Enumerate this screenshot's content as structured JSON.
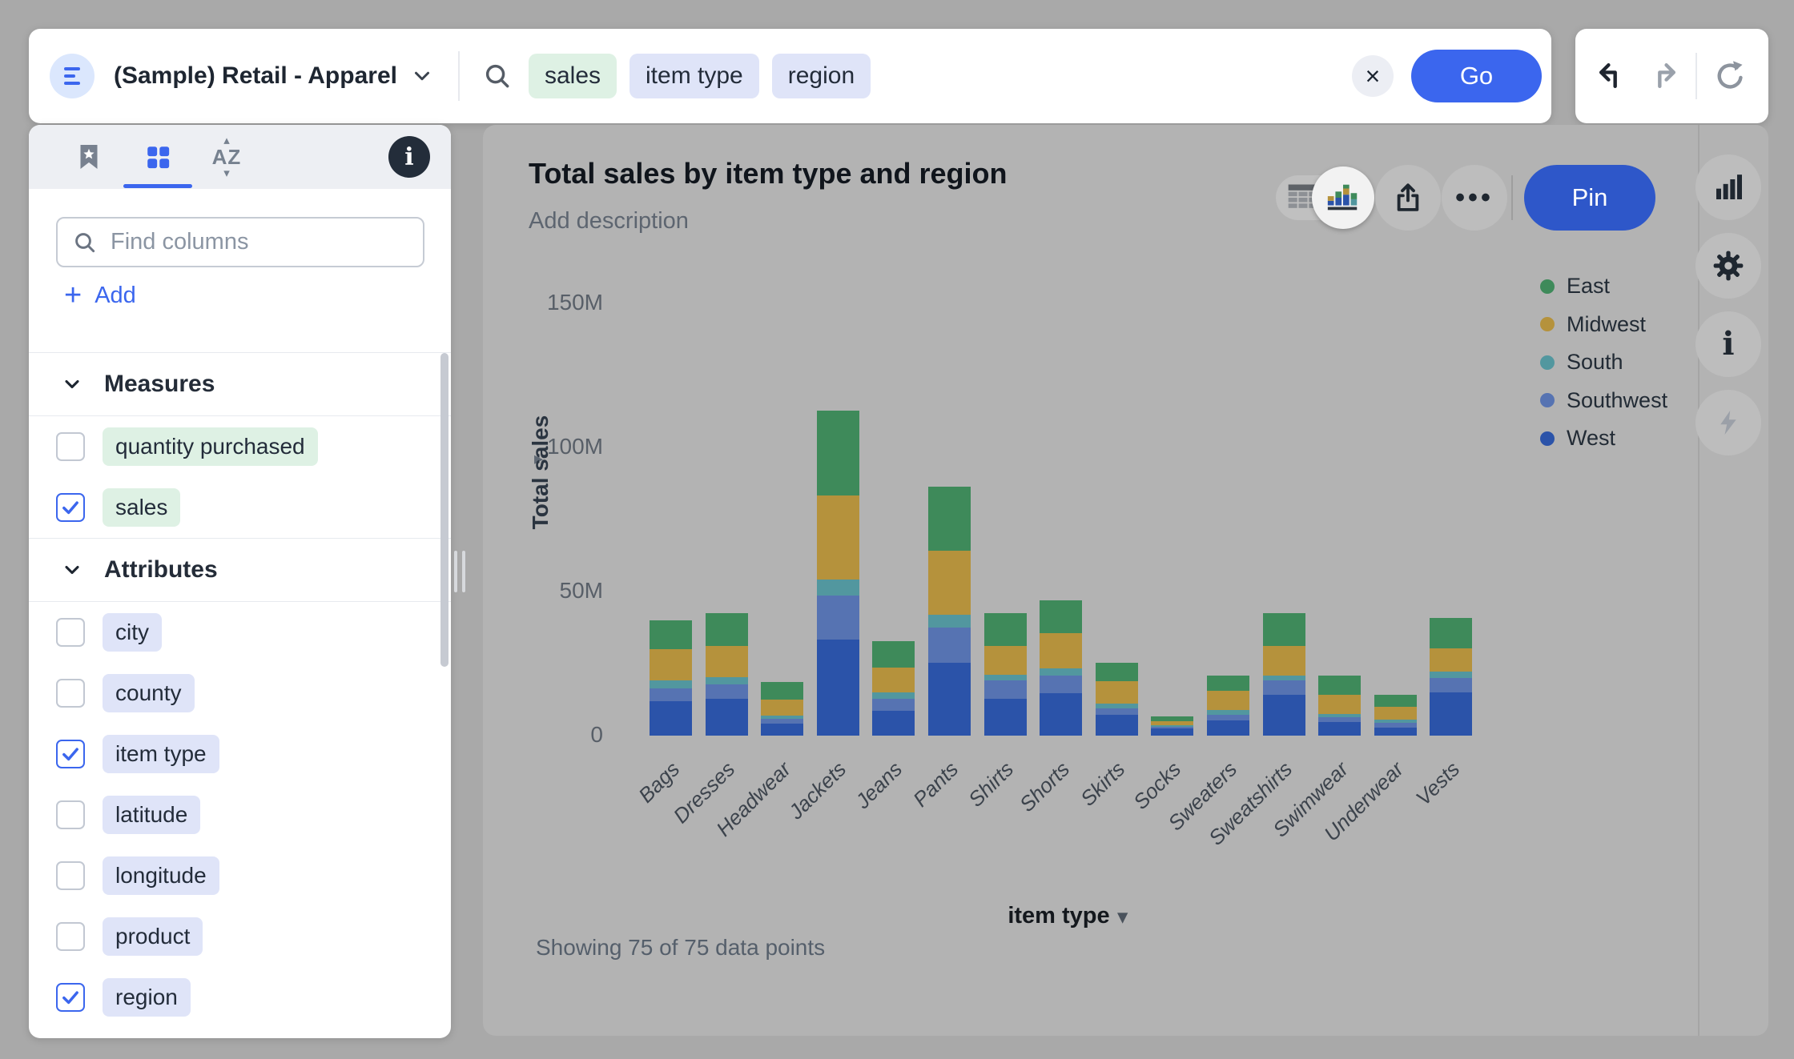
{
  "topbar": {
    "datasource": "(Sample) Retail - Apparel",
    "tokens": [
      {
        "text": "sales",
        "kind": "measure"
      },
      {
        "text": "item type",
        "kind": "attribute"
      },
      {
        "text": "region",
        "kind": "attribute"
      }
    ],
    "go_label": "Go",
    "clear_glyph": "×"
  },
  "history": {
    "undo": "undo",
    "redo": "redo",
    "reset": "reset"
  },
  "sidebar": {
    "search_placeholder": "Find columns",
    "add_label": "Add",
    "add_plus_glyph": "+",
    "az_text": "AZ",
    "info_glyph": "i",
    "sections": [
      {
        "title": "Measures",
        "items": [
          {
            "label": "quantity purchased",
            "kind": "measure",
            "checked": false
          },
          {
            "label": "sales",
            "kind": "measure",
            "checked": true
          }
        ]
      },
      {
        "title": "Attributes",
        "items": [
          {
            "label": "city",
            "kind": "attribute",
            "checked": false
          },
          {
            "label": "county",
            "kind": "attribute",
            "checked": false
          },
          {
            "label": "item type",
            "kind": "attribute",
            "checked": true
          },
          {
            "label": "latitude",
            "kind": "attribute",
            "checked": false
          },
          {
            "label": "longitude",
            "kind": "attribute",
            "checked": false
          },
          {
            "label": "product",
            "kind": "attribute",
            "checked": false
          },
          {
            "label": "region",
            "kind": "attribute",
            "checked": true
          }
        ]
      }
    ]
  },
  "answer": {
    "title": "Total sales by item type and region",
    "description_placeholder": "Add description",
    "pin_label": "Pin",
    "more_glyph": "•••",
    "footer": "Showing 75 of 75 data points",
    "rail_icons": [
      "bar-chart-icon",
      "gear-icon",
      "info-icon",
      "lightning-icon"
    ]
  },
  "chart_data": {
    "type": "bar",
    "stacked": true,
    "title": "Total sales by item type and region",
    "xlabel": "item type",
    "ylabel": "Total sales",
    "units": "millions",
    "ylim": [
      0,
      150000000
    ],
    "grid": false,
    "legend_position": "top-right",
    "legend_order": [
      "East",
      "Midwest",
      "South",
      "Southwest",
      "West"
    ],
    "yticks": [
      {
        "label": "0",
        "value": 0
      },
      {
        "label": "50M",
        "value": 50
      },
      {
        "label": "100M",
        "value": 100
      },
      {
        "label": "150M",
        "value": 150
      }
    ],
    "categories": [
      "Bags",
      "Dresses",
      "Headwear",
      "Jackets",
      "Jeans",
      "Pants",
      "Shirts",
      "Shorts",
      "Skirts",
      "Socks",
      "Sweaters",
      "Sweatshirts",
      "Swimwear",
      "Underwear",
      "Vests"
    ],
    "series": [
      {
        "name": "West",
        "color": "#2b53a9",
        "values": [
          12.0,
          12.9,
          4.1,
          33.4,
          8.6,
          25.2,
          12.9,
          14.8,
          7.3,
          2.5,
          5.3,
          14.2,
          4.7,
          2.8,
          15.1
        ]
      },
      {
        "name": "Southwest",
        "color": "#5673b2",
        "values": [
          4.4,
          4.9,
          1.7,
          15.3,
          4.2,
          12.3,
          6.3,
          6.1,
          2.2,
          0.6,
          2.0,
          5.0,
          1.7,
          1.6,
          4.9
        ]
      },
      {
        "name": "South",
        "color": "#52979f",
        "values": [
          2.8,
          2.6,
          1.1,
          5.6,
          2.2,
          4.4,
          1.9,
          2.5,
          1.6,
          0.5,
          1.5,
          1.7,
          1.1,
          1.1,
          2.3
        ]
      },
      {
        "name": "Midwest",
        "color": "#b5923c",
        "values": [
          10.7,
          10.8,
          5.6,
          29.0,
          8.6,
          22.4,
          10.1,
          12.1,
          7.8,
          1.4,
          6.7,
          10.1,
          6.7,
          4.5,
          8.1
        ]
      },
      {
        "name": "East",
        "color": "#3e8a5a",
        "values": [
          10.0,
          11.2,
          6.0,
          29.6,
          9.3,
          22.2,
          11.4,
          11.4,
          6.3,
          1.6,
          5.2,
          11.6,
          6.5,
          4.2,
          10.4
        ]
      }
    ],
    "footer": "Showing 75 of 75 data points"
  },
  "colors": {
    "accent_blue": "#3b66ee",
    "pin_blue": "#2e57c9",
    "measure_chip_bg": "#def1e4",
    "attribute_chip_bg": "#dfe4f8",
    "card_gray": "#b3b3b3"
  }
}
